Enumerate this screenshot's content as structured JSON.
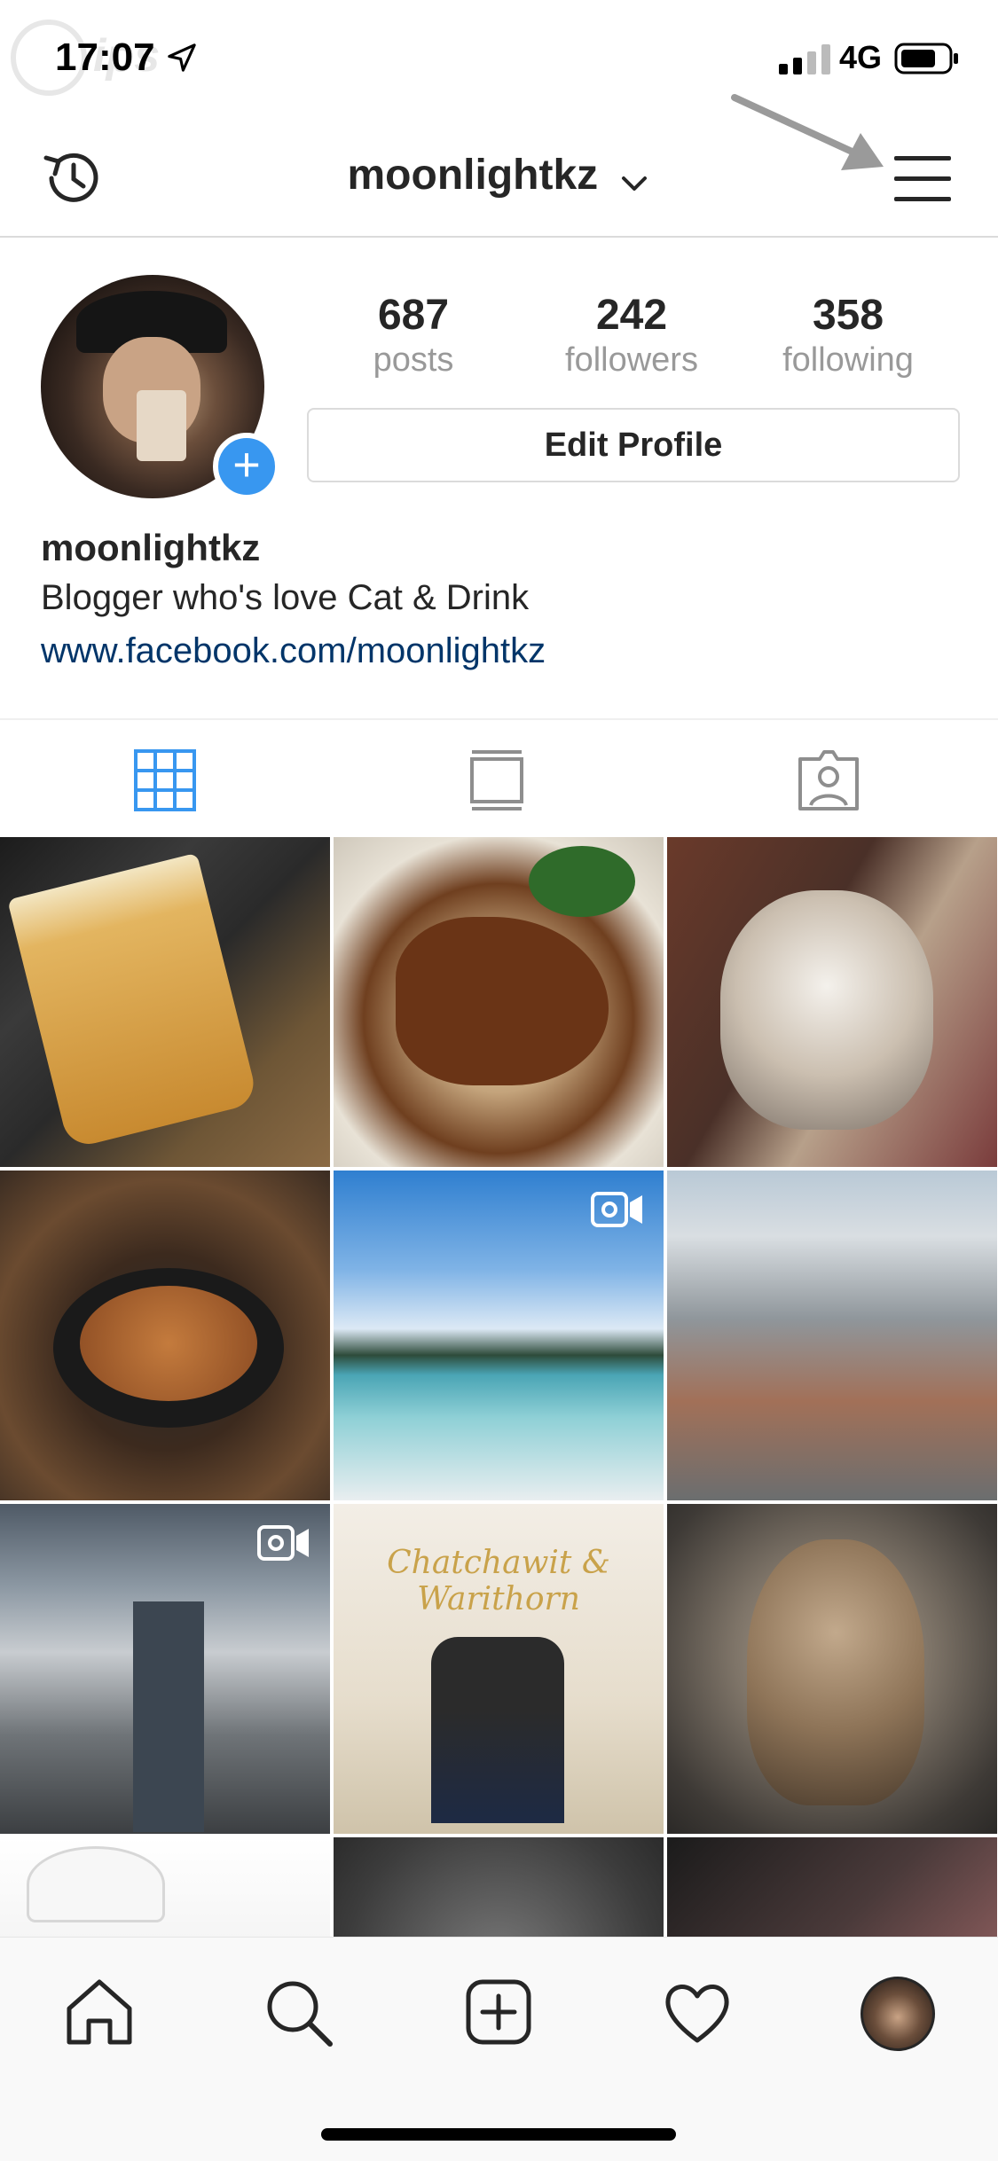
{
  "status_bar": {
    "time": "17:07",
    "network": "4G"
  },
  "header": {
    "title": "moonlightkz"
  },
  "profile": {
    "posts": "687",
    "posts_label": "posts",
    "followers": "242",
    "followers_label": "followers",
    "following": "358",
    "following_label": "following",
    "edit_button": "Edit Profile",
    "username": "moonlightkz",
    "bio": "Blogger who's love Cat & Drink",
    "link": "www.facebook.com/moonlightkz"
  },
  "grid": {
    "wedding_text": "Chatchawit & Warithorn"
  },
  "colors": {
    "accent": "#3897f0",
    "link": "#003569",
    "muted": "#999999",
    "border": "#dbdbdb"
  },
  "icons": {
    "header": [
      "history-icon",
      "chevron-down-icon",
      "menu-icon"
    ],
    "tabs": [
      "grid-icon",
      "feed-icon",
      "tagged-icon"
    ],
    "nav": [
      "home-icon",
      "search-icon",
      "add-icon",
      "heart-icon",
      "profile-avatar-icon"
    ]
  }
}
